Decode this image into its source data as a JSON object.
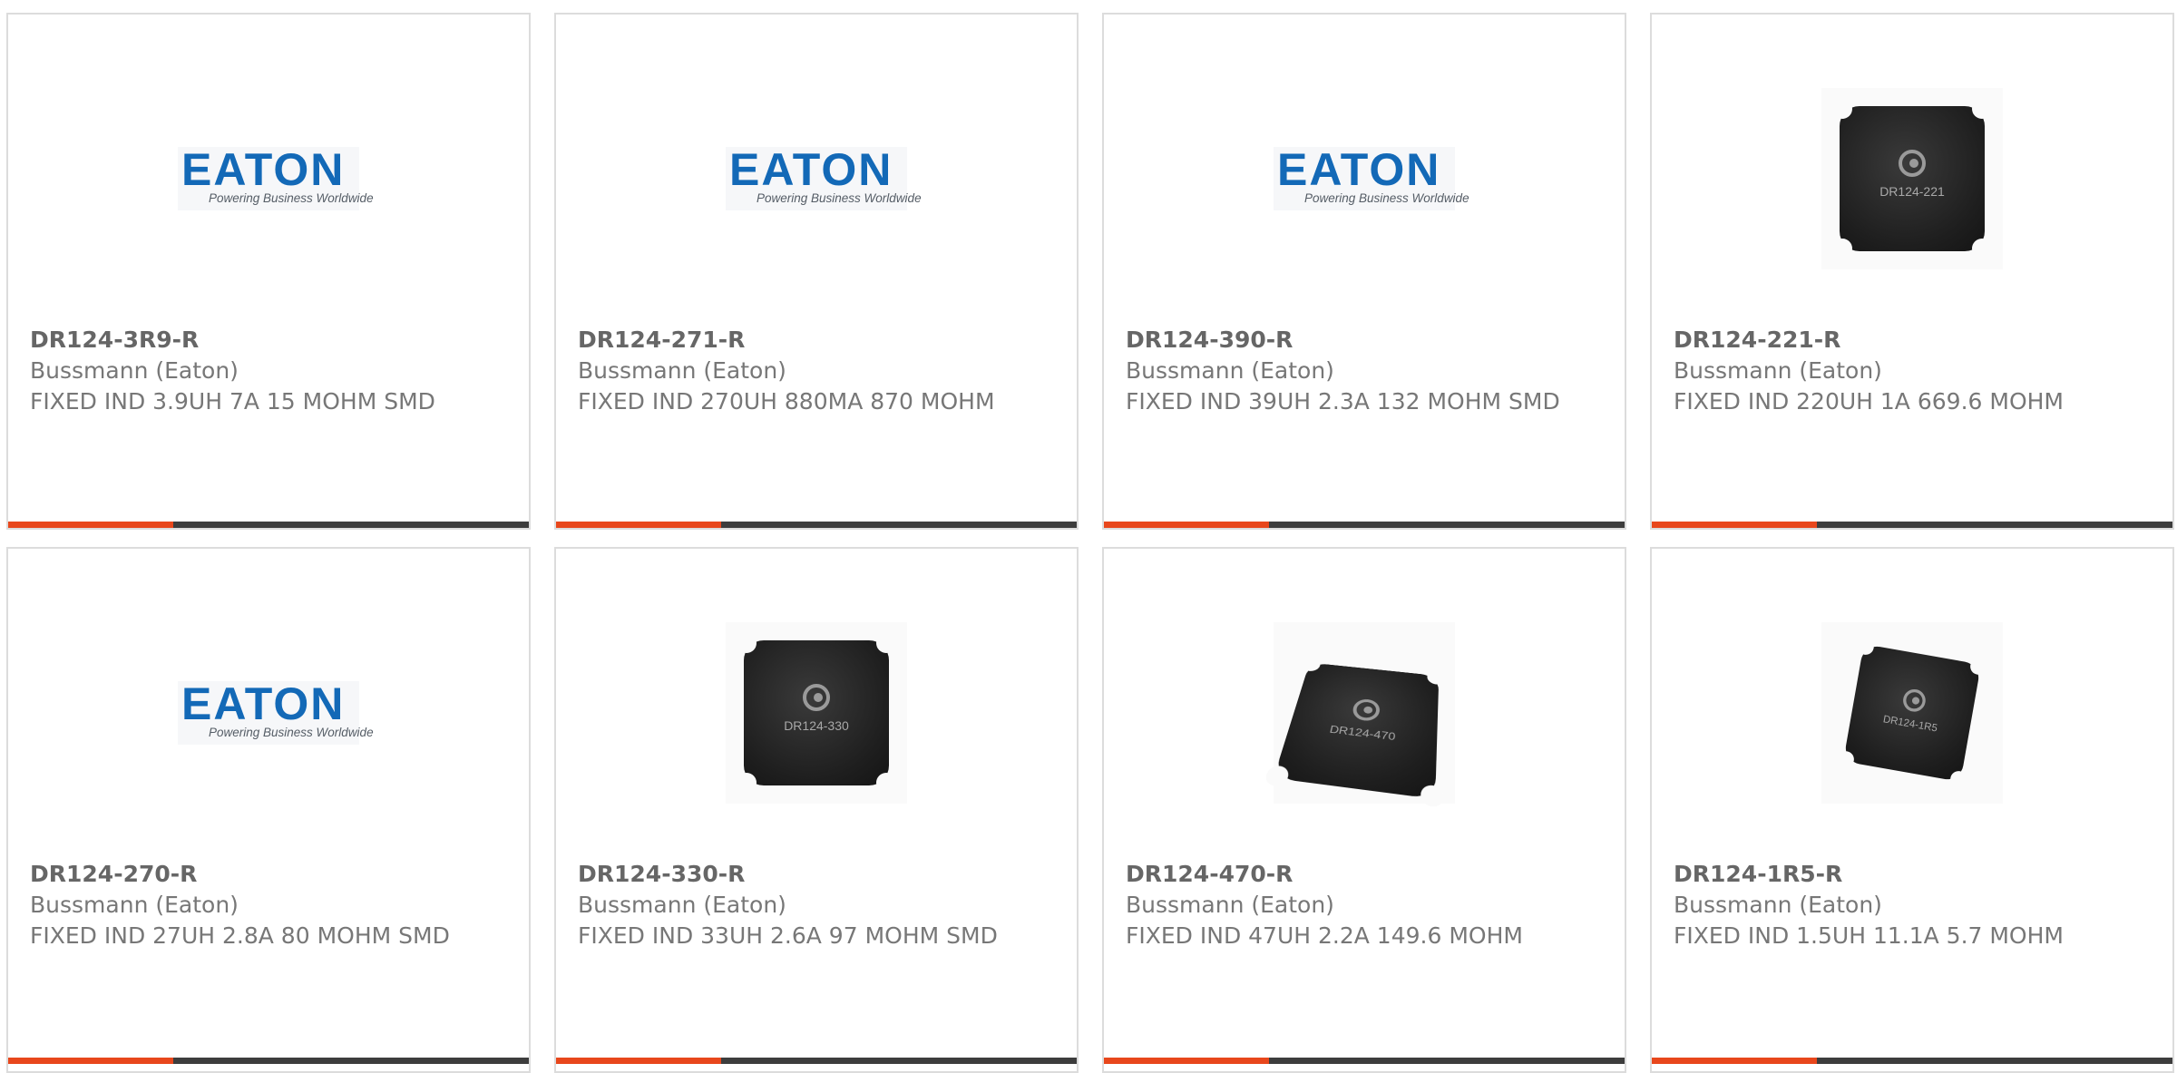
{
  "colors": {
    "accent": "#e8471c",
    "bar": "#3d3d3d",
    "brand": "#1369b7"
  },
  "logo": {
    "word": "EATON",
    "tagline": "Powering Business Worldwide"
  },
  "products": [
    {
      "part_number": "DR124-3R9-R",
      "manufacturer": "Bussmann (Eaton)",
      "description": "FIXED IND 3.9UH 7A 15 MOHM SMD",
      "image": "eaton-logo"
    },
    {
      "part_number": "DR124-271-R",
      "manufacturer": "Bussmann (Eaton)",
      "description": "FIXED IND 270UH 880MA 870 MOHM",
      "image": "eaton-logo"
    },
    {
      "part_number": "DR124-390-R",
      "manufacturer": "Bussmann (Eaton)",
      "description": "FIXED IND 39UH 2.3A 132 MOHM SMD",
      "image": "eaton-logo"
    },
    {
      "part_number": "DR124-221-R",
      "manufacturer": "Bussmann (Eaton)",
      "description": "FIXED IND 220UH 1A 669.6 MOHM",
      "image": "inductor-photo",
      "marking": "DR124-221"
    },
    {
      "part_number": "DR124-270-R",
      "manufacturer": "Bussmann (Eaton)",
      "description": "FIXED IND 27UH 2.8A 80 MOHM SMD",
      "image": "eaton-logo"
    },
    {
      "part_number": "DR124-330-R",
      "manufacturer": "Bussmann (Eaton)",
      "description": "FIXED IND 33UH 2.6A 97 MOHM SMD",
      "image": "inductor-photo",
      "marking": "DR124-330"
    },
    {
      "part_number": "DR124-470-R",
      "manufacturer": "Bussmann (Eaton)",
      "description": "FIXED IND 47UH 2.2A 149.6 MOHM",
      "image": "inductor-photo",
      "marking": "DR124-470"
    },
    {
      "part_number": "DR124-1R5-R",
      "manufacturer": "Bussmann (Eaton)",
      "description": "FIXED IND 1.5UH 11.1A 5.7 MOHM",
      "image": "inductor-photo",
      "marking": "DR124-1R5"
    }
  ]
}
